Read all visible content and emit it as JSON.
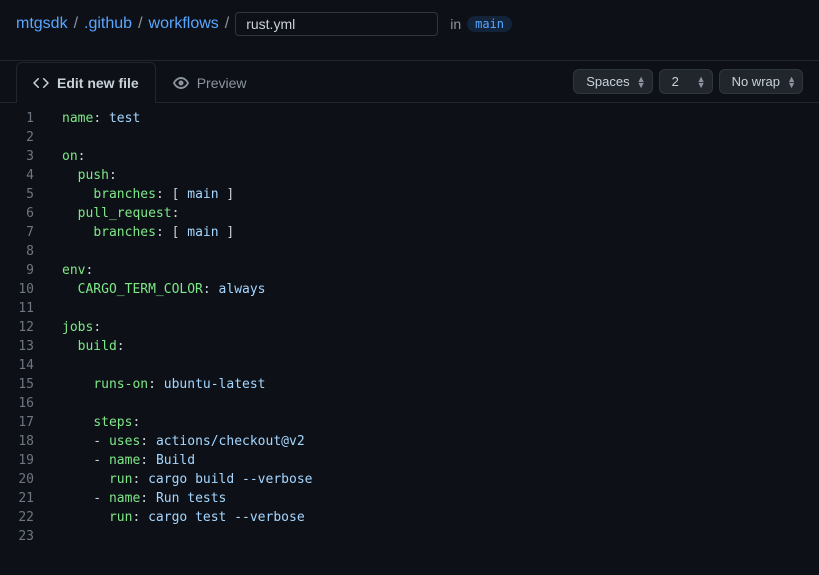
{
  "breadcrumb": {
    "repo": "mtgsdk",
    "dir1": ".github",
    "dir2": "workflows",
    "filename": "rust.yml",
    "in_label": "in",
    "branch": "main"
  },
  "tabs": {
    "edit": "Edit new file",
    "preview": "Preview"
  },
  "controls": {
    "indent_mode": "Spaces",
    "indent_size": "2",
    "wrap_mode": "No wrap"
  },
  "code": {
    "lines": [
      {
        "n": "1",
        "seg": [
          {
            "c": "k",
            "t": "name"
          },
          {
            "c": "p",
            "t": ": "
          },
          {
            "c": "s",
            "t": "test"
          }
        ]
      },
      {
        "n": "2",
        "seg": []
      },
      {
        "n": "3",
        "seg": [
          {
            "c": "k",
            "t": "on"
          },
          {
            "c": "p",
            "t": ":"
          }
        ]
      },
      {
        "n": "4",
        "seg": [
          {
            "c": "p",
            "t": "  "
          },
          {
            "c": "k",
            "t": "push"
          },
          {
            "c": "p",
            "t": ":"
          }
        ]
      },
      {
        "n": "5",
        "seg": [
          {
            "c": "p",
            "t": "    "
          },
          {
            "c": "k",
            "t": "branches"
          },
          {
            "c": "p",
            "t": ": [ "
          },
          {
            "c": "s",
            "t": "main"
          },
          {
            "c": "p",
            "t": " ]"
          }
        ]
      },
      {
        "n": "6",
        "seg": [
          {
            "c": "p",
            "t": "  "
          },
          {
            "c": "k",
            "t": "pull_request"
          },
          {
            "c": "p",
            "t": ":"
          }
        ]
      },
      {
        "n": "7",
        "seg": [
          {
            "c": "p",
            "t": "    "
          },
          {
            "c": "k",
            "t": "branches"
          },
          {
            "c": "p",
            "t": ": [ "
          },
          {
            "c": "s",
            "t": "main"
          },
          {
            "c": "p",
            "t": " ]"
          }
        ]
      },
      {
        "n": "8",
        "seg": []
      },
      {
        "n": "9",
        "seg": [
          {
            "c": "k",
            "t": "env"
          },
          {
            "c": "p",
            "t": ":"
          }
        ]
      },
      {
        "n": "10",
        "seg": [
          {
            "c": "p",
            "t": "  "
          },
          {
            "c": "k",
            "t": "CARGO_TERM_COLOR"
          },
          {
            "c": "p",
            "t": ": "
          },
          {
            "c": "s",
            "t": "always"
          }
        ]
      },
      {
        "n": "11",
        "seg": []
      },
      {
        "n": "12",
        "seg": [
          {
            "c": "k",
            "t": "jobs"
          },
          {
            "c": "p",
            "t": ":"
          }
        ]
      },
      {
        "n": "13",
        "seg": [
          {
            "c": "p",
            "t": "  "
          },
          {
            "c": "k",
            "t": "build"
          },
          {
            "c": "p",
            "t": ":"
          }
        ]
      },
      {
        "n": "14",
        "seg": []
      },
      {
        "n": "15",
        "seg": [
          {
            "c": "p",
            "t": "    "
          },
          {
            "c": "k",
            "t": "runs-on"
          },
          {
            "c": "p",
            "t": ": "
          },
          {
            "c": "s",
            "t": "ubuntu-latest"
          }
        ]
      },
      {
        "n": "16",
        "seg": []
      },
      {
        "n": "17",
        "seg": [
          {
            "c": "p",
            "t": "    "
          },
          {
            "c": "k",
            "t": "steps"
          },
          {
            "c": "p",
            "t": ":"
          }
        ]
      },
      {
        "n": "18",
        "seg": [
          {
            "c": "p",
            "t": "    - "
          },
          {
            "c": "k",
            "t": "uses"
          },
          {
            "c": "p",
            "t": ": "
          },
          {
            "c": "s",
            "t": "actions/checkout@v2"
          }
        ]
      },
      {
        "n": "19",
        "seg": [
          {
            "c": "p",
            "t": "    - "
          },
          {
            "c": "k",
            "t": "name"
          },
          {
            "c": "p",
            "t": ": "
          },
          {
            "c": "s",
            "t": "Build"
          }
        ]
      },
      {
        "n": "20",
        "seg": [
          {
            "c": "p",
            "t": "      "
          },
          {
            "c": "k",
            "t": "run"
          },
          {
            "c": "p",
            "t": ": "
          },
          {
            "c": "s",
            "t": "cargo build --verbose"
          }
        ]
      },
      {
        "n": "21",
        "seg": [
          {
            "c": "p",
            "t": "    - "
          },
          {
            "c": "k",
            "t": "name"
          },
          {
            "c": "p",
            "t": ": "
          },
          {
            "c": "s",
            "t": "Run tests"
          }
        ]
      },
      {
        "n": "22",
        "seg": [
          {
            "c": "p",
            "t": "      "
          },
          {
            "c": "k",
            "t": "run"
          },
          {
            "c": "p",
            "t": ": "
          },
          {
            "c": "s",
            "t": "cargo test --verbose"
          }
        ]
      },
      {
        "n": "23",
        "seg": []
      }
    ]
  }
}
